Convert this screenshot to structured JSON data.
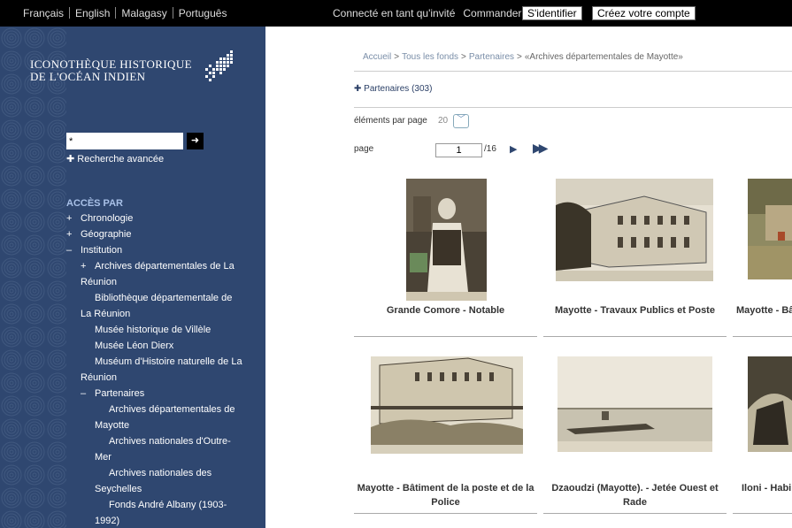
{
  "topbar": {
    "languages": [
      "Français",
      "English",
      "Malagasy",
      "Português"
    ],
    "connected_as": "Connecté en tant qu'invité",
    "order": "Commander",
    "login_button": "S'identifier",
    "signup_button": "Créez votre compte"
  },
  "logo": {
    "line1": "ICONOTHÈQUE HISTORIQUE",
    "line2": "DE L'OCÉAN INDIEN"
  },
  "search": {
    "value": "*",
    "go_icon": "arrow-right-icon",
    "advanced": "Recherche avancée"
  },
  "access": {
    "title": "ACCÈS PAR",
    "tree": [
      {
        "mark": "+",
        "label": "Chronologie"
      },
      {
        "mark": "+",
        "label": "Géographie"
      },
      {
        "mark": "–",
        "label": "Institution"
      },
      {
        "mark": "+",
        "label": "Archives départementales de La",
        "cont": "Réunion"
      },
      {
        "mark": "",
        "label": "Bibliothèque départementale de",
        "cont": "La Réunion"
      },
      {
        "mark": "",
        "label": "Musée historique de Villèle"
      },
      {
        "mark": "",
        "label": "Musée Léon Dierx"
      },
      {
        "mark": "",
        "label": "Muséum d'Histoire naturelle de La",
        "cont": "Réunion"
      },
      {
        "mark": "–",
        "label": "Partenaires"
      },
      {
        "mark": "",
        "label": "Archives départementales de",
        "cont": "Mayotte"
      },
      {
        "mark": "",
        "label": "Archives nationales d'Outre-",
        "cont": "Mer"
      },
      {
        "mark": "",
        "label": "Archives nationales des",
        "cont": "Seychelles"
      },
      {
        "mark": "",
        "label": "Fonds André Albany (1903-",
        "cont": "1992)"
      }
    ]
  },
  "breadcrumb": {
    "items": [
      "Accueil",
      "Tous les fonds",
      "Partenaires",
      "«Archives départementales de Mayotte»"
    ]
  },
  "partenaires_link": "Partenaires (303)",
  "pagination": {
    "per_page_label": "éléments par page",
    "per_page_value": "20",
    "page_label": "page",
    "page_value": "1",
    "page_total": "/16"
  },
  "results": [
    {
      "title": "Grande Comore - Notable"
    },
    {
      "title": "Mayotte - Travaux Publics et Poste"
    },
    {
      "title": "Mayotte - Bâ"
    },
    {
      "title": "Mayotte - Bâtiment de la poste et de la Police"
    },
    {
      "title": "Dzaoudzi (Mayotte). - Jetée Ouest et Rade"
    },
    {
      "title": "Iloni - Habi"
    }
  ],
  "colors": {
    "sidebar_bg": "#2f4770",
    "accent": "#a9c1e8"
  }
}
